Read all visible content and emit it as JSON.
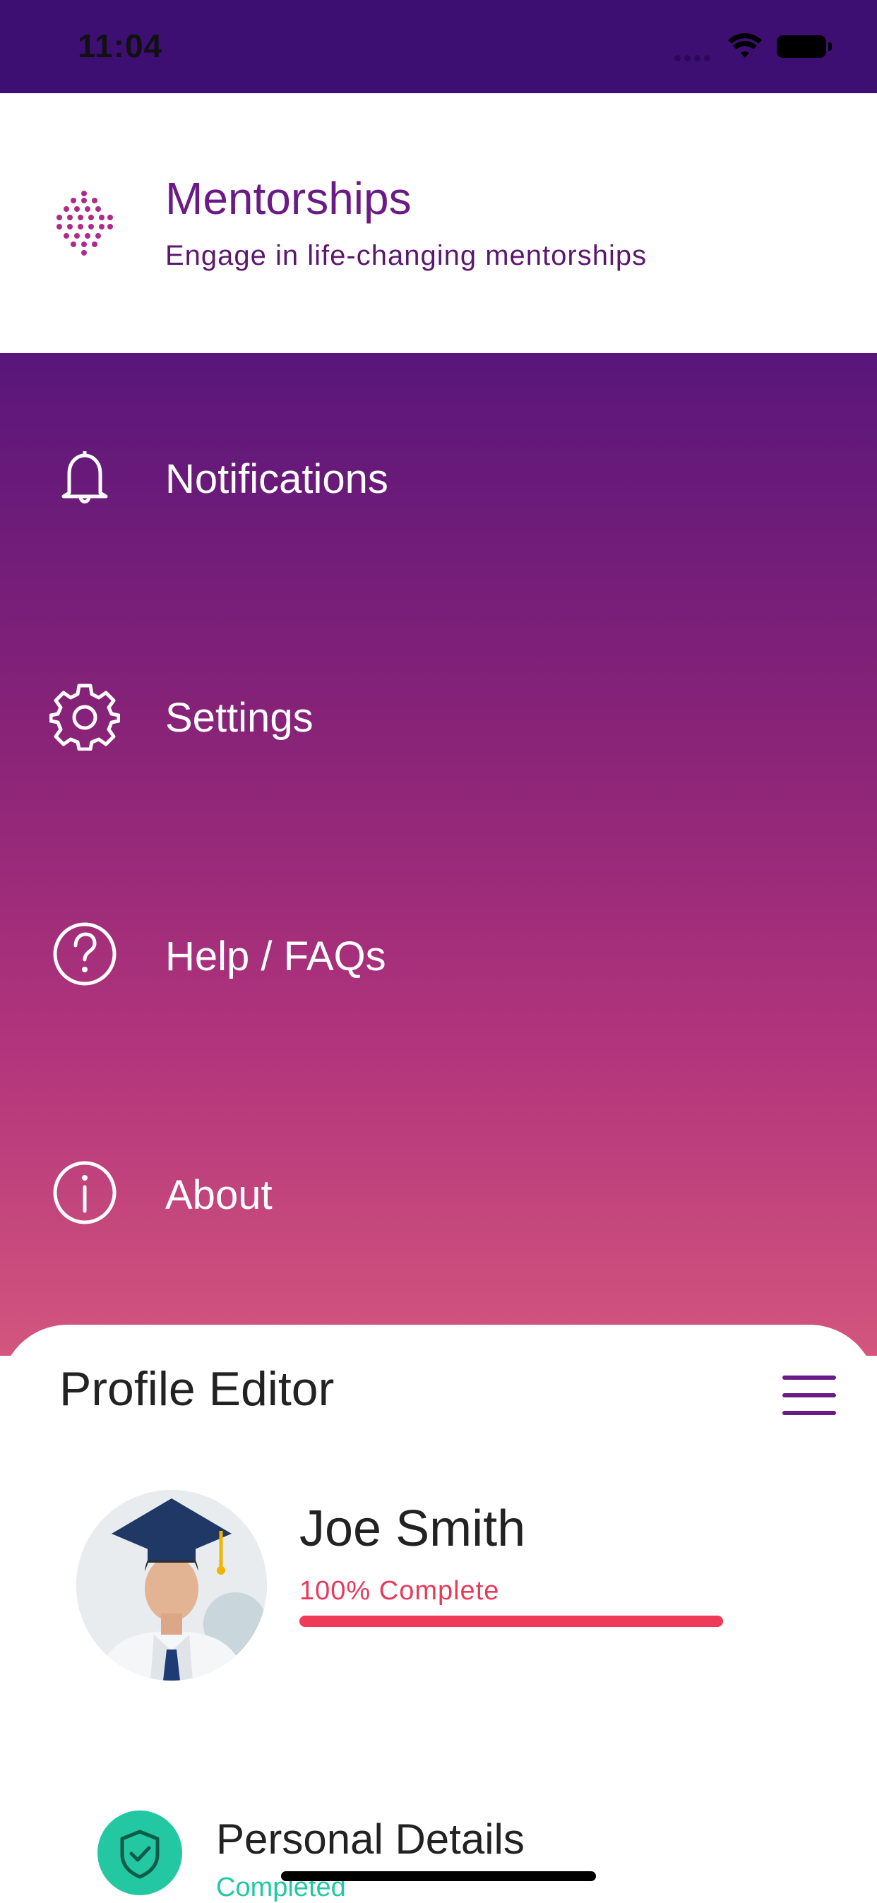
{
  "status_bar": {
    "time": "11:04"
  },
  "brand": {
    "title": "Mentorships",
    "subtitle": "Engage in life-changing mentorships"
  },
  "menu": {
    "items": [
      {
        "label": "Notifications",
        "icon": "bell-icon"
      },
      {
        "label": "Settings",
        "icon": "gear-icon"
      },
      {
        "label": "Help / FAQs",
        "icon": "help-icon"
      },
      {
        "label": "About",
        "icon": "info-icon"
      }
    ]
  },
  "profile_editor": {
    "title": "Profile Editor",
    "user": {
      "name": "Joe Smith",
      "progress_text": "100% Complete",
      "progress_fraction": 1.0
    },
    "sections": [
      {
        "title": "Personal Details",
        "status": "Completed",
        "icon": "shield-check-icon"
      }
    ]
  },
  "colors": {
    "brand_purple": "#6a1b86",
    "progress_red": "#ef3a58",
    "success_teal": "#23c8a2"
  }
}
